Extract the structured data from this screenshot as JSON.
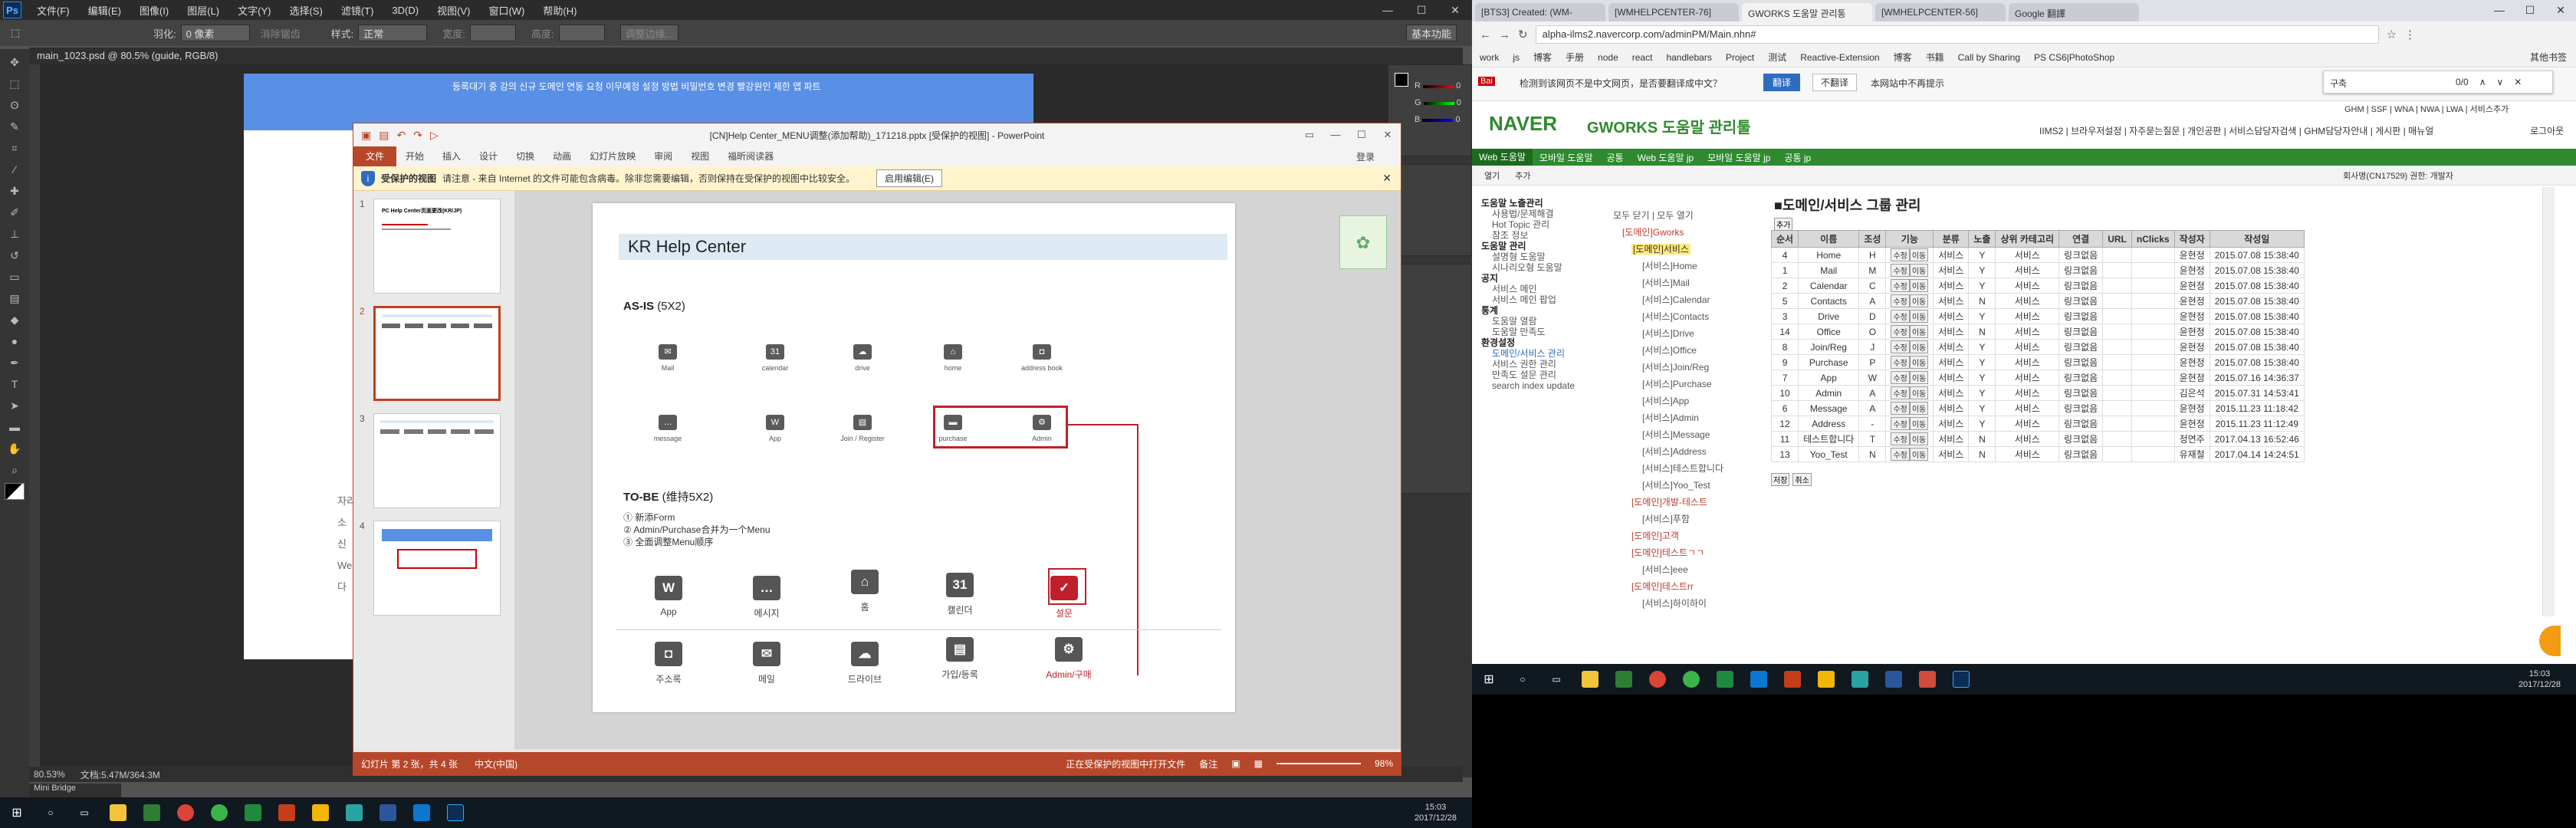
{
  "ps": {
    "menu": [
      "文件(F)",
      "编辑(E)",
      "图像(I)",
      "图层(L)",
      "文字(Y)",
      "选择(S)",
      "滤镜(T)",
      "3D(D)",
      "视图(V)",
      "窗口(W)",
      "帮助(H)"
    ],
    "logo": "Ps",
    "opts": {
      "feather_label": "羽化:",
      "feather_value": "0 像素",
      "smooth": "消除锯齿",
      "style_label": "样式:",
      "style_value": "正常",
      "width": "宽度:",
      "height": "高度:",
      "refine": "调整边缘...",
      "workspace": "基本功能"
    },
    "doc_tab": "main_1023.psd @ 80.5% (guide, RGB/8)",
    "web_nav": "등록대기 중 강의   신규 도메인 연동 요청   이무예정 설정 방법   비밀번호 변경   빨강원인 제한 앱 파트",
    "side_text": [
      "자리",
      "소",
      "신",
      "We",
      "다"
    ],
    "status_zoom": "80.53%",
    "status_doc": "文档:5.47M/364.3M",
    "minibridge": "Mini Bridge",
    "panel_labels": [
      "R",
      "G",
      "B"
    ],
    "panel_values": [
      "0",
      "0",
      "0"
    ]
  },
  "pp": {
    "title": "[CN]Help Center_MENU调整(添加帮助)_171218.pptx [受保护的视图] - PowerPoint",
    "tabs": [
      "文件",
      "开始",
      "插入",
      "设计",
      "切换",
      "动画",
      "幻灯片放映",
      "审阅",
      "视图",
      "福昕阅读器"
    ],
    "login": "登录",
    "warn_title": "受保护的视图",
    "warn_text": "请注意 - 来自 Internet 的文件可能包含病毒。除非您需要编辑，否则保持在受保护的视图中比较安全。",
    "warn_button": "启用编辑(E)",
    "thumb_nums": [
      "1",
      "2",
      "3",
      "4"
    ],
    "thumb1_title": "PC Help Center页面更改(KR/JP)",
    "status": {
      "slide": "幻灯片 第 2 张，共 4 张",
      "lang": "中文(中国)",
      "opening": "正在受保护的视图中打开文件",
      "notes": "备注",
      "zoom": "98%"
    },
    "slide": {
      "title": "KR Help Center",
      "asis": "AS-IS",
      "asis_sub": "(5X2)",
      "asis_icons": [
        "Mail",
        "calendar",
        "drive",
        "home",
        "address book",
        "message",
        "App",
        "Join / Register",
        "purchase",
        "Admin"
      ],
      "tobe": "TO-BE",
      "tobe_sub": "(维持5X2)",
      "notes": [
        "① 新添Form",
        "② Admin/Purchase合并为一个Menu",
        "③ 全面调整Menu顺序"
      ],
      "tobe_icons": [
        "App",
        "메시지",
        "홈",
        "캘린더",
        "설문",
        "주소록",
        "메일",
        "드라이브",
        "가입/등록",
        "Admin/구매"
      ]
    }
  },
  "chrome": {
    "tabs": [
      "[BTS3] Created: (WM-",
      "[WMHELPCENTER-76]",
      "GWORKS 도움말 관리통",
      "[WMHELPCENTER-56]",
      "Google 翻譯"
    ],
    "url": "alpha-ilms2.navercorp.com/adminPM/Main.nhn#",
    "bookmarks": [
      "work",
      "js",
      "博客",
      "手册",
      "node",
      "react",
      "handlebars",
      "Project",
      "测试",
      "Reactive-Extension",
      "博客",
      "书籍",
      "Call by Sharing",
      "PS CS6|PhotoShop",
      "其他书签"
    ],
    "translate_text": "检测到该网页不是中文网页，是否要翻译成中文？",
    "translate_btn": "翻译",
    "no_translate": "不翻译",
    "never": "本网站中不再提示",
    "find_text": "구축",
    "find_count": "0/0",
    "naver_logo": "NAVER",
    "gworks": "GWORKS 도움말 관리툴",
    "top_links": "IIMS2 | 브라우저설정 | 자주묻는질문 | 개인공판 | 서비스담당자검색 | GHM담당자안내 | 게시판 | 매뉴얼",
    "logout": "로그아웃",
    "service_links": "GHM | SSF | WNA | NWA | LWA | 서비스추가",
    "menu": [
      "Web 도움말",
      "모바일 도움말",
      "공통",
      "Web 도움말 jp",
      "모바일 도움말 jp",
      "공통 jp"
    ],
    "sub_left": [
      "열기",
      "추가"
    ],
    "sub_right": "회사명(CN17529)   권한: 개발자",
    "leftnav": [
      {
        "h": "도움말 노출관리",
        "items": [
          "사용법/문제해결",
          "Hot Topic 관리",
          "참조 정보"
        ]
      },
      {
        "h": "도움말 관리",
        "items": [
          "설명형 도움말",
          "시나리오형 도움말"
        ]
      },
      {
        "h": "공지",
        "items": [
          "서비스 메인",
          "서비스 메인 팝업"
        ]
      },
      {
        "h": "통계",
        "items": [
          "도움말 열람",
          "도움말 만족도"
        ]
      },
      {
        "h": "환경설정",
        "items": [
          "도메인/서비스 관리",
          "서비스 권한 관리",
          "만족도 설문 관리",
          "search index update"
        ]
      }
    ],
    "tree_actions": "모두 닫기 | 모두 열기",
    "tree": [
      "[도메인]Gworks",
      "[도메인]서비스",
      "[서비스]Home",
      "[서비스]Mail",
      "[서비스]Calendar",
      "[서비스]Contacts",
      "[서비스]Drive",
      "[서비스]Office",
      "[서비스]Join/Reg",
      "[서비스]Purchase",
      "[서비스]App",
      "[서비스]Admin",
      "[서비스]Message",
      "[서비스]Address",
      "[서비스]테스트합니다",
      "[서비스]Yoo_Test",
      "[도메인]개발-테스트",
      "[서비스]푸함",
      "[도메인]고객",
      "[도메인]테스트ㄱㄱ",
      "[서비스]eee",
      "[도메인]테스트rr",
      "[서비스]하이하이"
    ],
    "page_title": "■도메인/서비스 그룹 관리",
    "add_btn": "추가",
    "headers": [
      "순서",
      "이름",
      "조성",
      "기능",
      "분류",
      "노출",
      "상위 카테고리",
      "연결",
      "URL",
      "nClicks",
      "작성자",
      "작성일"
    ],
    "rows": [
      [
        "4",
        "Home",
        "H",
        "서비스",
        "Y",
        "서비스",
        "링크없음",
        "",
        "",
        "윤현정",
        "2015.07.08 15:38:40"
      ],
      [
        "1",
        "Mail",
        "M",
        "서비스",
        "Y",
        "서비스",
        "링크없음",
        "",
        "",
        "윤현정",
        "2015.07.08 15:38:40"
      ],
      [
        "2",
        "Calendar",
        "C",
        "서비스",
        "Y",
        "서비스",
        "링크없음",
        "",
        "",
        "윤현정",
        "2015.07.08 15:38:40"
      ],
      [
        "5",
        "Contacts",
        "A",
        "서비스",
        "N",
        "서비스",
        "링크없음",
        "",
        "",
        "윤현정",
        "2015.07.08 15:38:40"
      ],
      [
        "3",
        "Drive",
        "D",
        "서비스",
        "Y",
        "서비스",
        "링크없음",
        "",
        "",
        "윤현정",
        "2015.07.08 15:38:40"
      ],
      [
        "14",
        "Office",
        "O",
        "서비스",
        "N",
        "서비스",
        "링크없음",
        "",
        "",
        "윤현정",
        "2015.07.08 15:38:40"
      ],
      [
        "8",
        "Join/Reg",
        "J",
        "서비스",
        "Y",
        "서비스",
        "링크없음",
        "",
        "",
        "윤현정",
        "2015.07.08 15:38:40"
      ],
      [
        "9",
        "Purchase",
        "P",
        "서비스",
        "Y",
        "서비스",
        "링크없음",
        "",
        "",
        "윤현정",
        "2015.07.08 15:38:40"
      ],
      [
        "7",
        "App",
        "W",
        "서비스",
        "Y",
        "서비스",
        "링크없음",
        "",
        "",
        "윤현정",
        "2015.07.16 14:36:37"
      ],
      [
        "10",
        "Admin",
        "A",
        "서비스",
        "Y",
        "서비스",
        "링크없음",
        "",
        "",
        "김은석",
        "2015.07.31 14:53:41"
      ],
      [
        "6",
        "Message",
        "A",
        "서비스",
        "Y",
        "서비스",
        "링크없음",
        "",
        "",
        "윤현정",
        "2015.11.23 11:18:42"
      ],
      [
        "12",
        "Address",
        "-",
        "서비스",
        "Y",
        "서비스",
        "링크없음",
        "",
        "",
        "윤현정",
        "2015.11.23 11:12:49"
      ],
      [
        "11",
        "테스트합니다",
        "T",
        "서비스",
        "N",
        "서비스",
        "링크없음",
        "",
        "",
        "정연주",
        "2017.04.13 16:52:46"
      ],
      [
        "13",
        "Yoo_Test",
        "N",
        "서비스",
        "N",
        "서비스",
        "링크없음",
        "",
        "",
        "유재철",
        "2017.04.14 14:24:51"
      ]
    ],
    "btn_edit": "수정",
    "btn_move": "이동",
    "bottom_btns": [
      "저장",
      "취소"
    ]
  },
  "taskbar": {
    "time": "15:03",
    "date": "2017/12/28"
  }
}
